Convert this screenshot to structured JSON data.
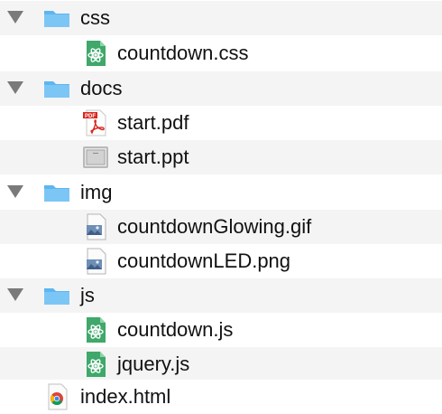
{
  "colors": {
    "stripe": "#f4f4f5",
    "folder": "#5cb6f0",
    "disclosure": "#7a7a7a",
    "atom_green": "#3fa86a"
  },
  "tree": [
    {
      "label": "css",
      "type": "folder",
      "icon": "folder-icon",
      "expanded": true
    },
    {
      "label": "countdown.css",
      "type": "file",
      "icon": "atom-file-icon"
    },
    {
      "label": "docs",
      "type": "folder",
      "icon": "folder-icon",
      "expanded": true
    },
    {
      "label": "start.pdf",
      "type": "file",
      "icon": "pdf-icon"
    },
    {
      "label": "start.ppt",
      "type": "file",
      "icon": "ppt-icon"
    },
    {
      "label": "img",
      "type": "folder",
      "icon": "folder-icon",
      "expanded": true
    },
    {
      "label": "countdownGlowing.gif",
      "type": "file",
      "icon": "image-file-icon"
    },
    {
      "label": "countdownLED.png",
      "type": "file",
      "icon": "image-file-icon"
    },
    {
      "label": "js",
      "type": "folder",
      "icon": "folder-icon",
      "expanded": true
    },
    {
      "label": "countdown.js",
      "type": "file",
      "icon": "atom-file-icon"
    },
    {
      "label": "jquery.js",
      "type": "file",
      "icon": "atom-file-icon"
    },
    {
      "label": "index.html",
      "type": "file",
      "icon": "chrome-html-icon"
    }
  ]
}
